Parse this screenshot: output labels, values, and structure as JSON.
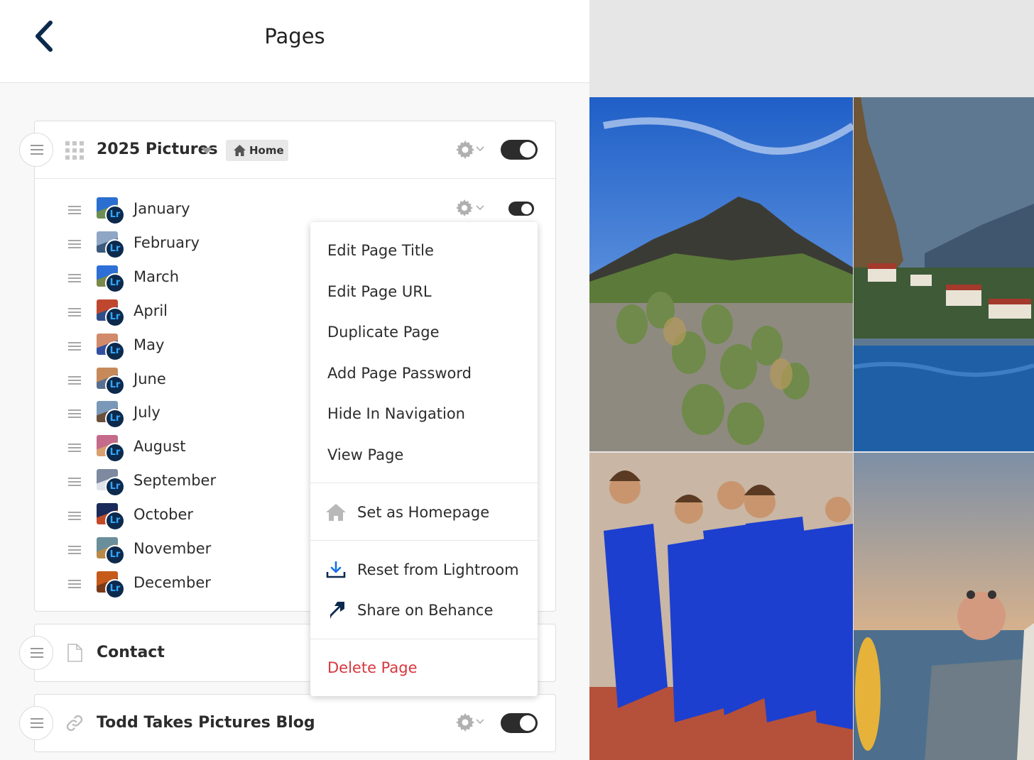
{
  "header": {
    "title": "Pages"
  },
  "sections": {
    "pictures": {
      "title": "2025 Pictures",
      "home_badge": "Home",
      "toggle_on": true,
      "items": [
        {
          "label": "January"
        },
        {
          "label": "February"
        },
        {
          "label": "March"
        },
        {
          "label": "April"
        },
        {
          "label": "May"
        },
        {
          "label": "June"
        },
        {
          "label": "July"
        },
        {
          "label": "August"
        },
        {
          "label": "September"
        },
        {
          "label": "October"
        },
        {
          "label": "November"
        },
        {
          "label": "December"
        }
      ],
      "badge_text": "Lr"
    },
    "contact": {
      "title": "Contact"
    },
    "blog": {
      "title": "Todd Takes Pictures Blog",
      "toggle_on": true
    }
  },
  "context_menu": {
    "edit_title": "Edit Page Title",
    "edit_url": "Edit Page URL",
    "duplicate": "Duplicate Page",
    "add_password": "Add Page Password",
    "hide_nav": "Hide In Navigation",
    "view": "View Page",
    "set_home": "Set as Homepage",
    "reset_lightroom": "Reset from Lightroom",
    "share_behance": "Share on Behance",
    "delete": "Delete Page"
  },
  "colors": {
    "accent_dark": "#0d2a4d",
    "lightroom_blue": "#31a8ff",
    "danger": "#d7373f",
    "toggle": "#2c2c2c"
  },
  "icons": [
    "back-chevron-icon",
    "drag-handle-icon",
    "grid-icon",
    "caret-down-icon",
    "home-icon",
    "gear-icon",
    "document-icon",
    "link-icon",
    "download-icon",
    "share-arrow-icon"
  ]
}
